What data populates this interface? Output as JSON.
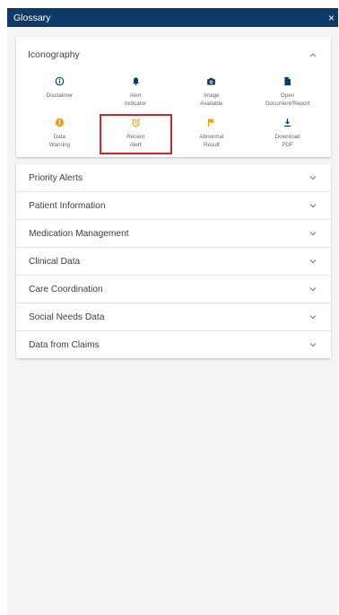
{
  "panel": {
    "title": "Glossary",
    "close_glyph": "×"
  },
  "iconography": {
    "title": "Iconography",
    "icons": [
      {
        "label_lines": [
          "Disclaimer"
        ],
        "icon": "info-circle-icon",
        "color": "#0e3a68"
      },
      {
        "label_lines": [
          "Alert",
          "Indicator"
        ],
        "icon": "bell-icon",
        "color": "#0e3a68"
      },
      {
        "label_lines": [
          "Image",
          "Available"
        ],
        "icon": "camera-icon",
        "color": "#0e3a68"
      },
      {
        "label_lines": [
          "Open",
          "Document/Report"
        ],
        "icon": "document-icon",
        "color": "#0e3a68"
      },
      {
        "label_lines": [
          "Data",
          "Warning"
        ],
        "icon": "warning-circle-icon",
        "color": "#f39c12"
      },
      {
        "label_lines": [
          "Recent",
          "Alert"
        ],
        "icon": "alarm-clock-icon",
        "color": "#f39c12"
      },
      {
        "label_lines": [
          "Abnormal",
          "Result"
        ],
        "icon": "flag-icon",
        "color": "#f39c12"
      },
      {
        "label_lines": [
          "Download",
          "PDF"
        ],
        "icon": "download-icon",
        "color": "#0e3a68"
      }
    ]
  },
  "sections": [
    "Priority Alerts",
    "Patient Information",
    "Medication Management",
    "Clinical Data",
    "Care Coordination",
    "Social Needs Data",
    "Data from Claims"
  ],
  "colors": {
    "titlebar": "#0e3a68",
    "highlight": "#d0262d"
  }
}
